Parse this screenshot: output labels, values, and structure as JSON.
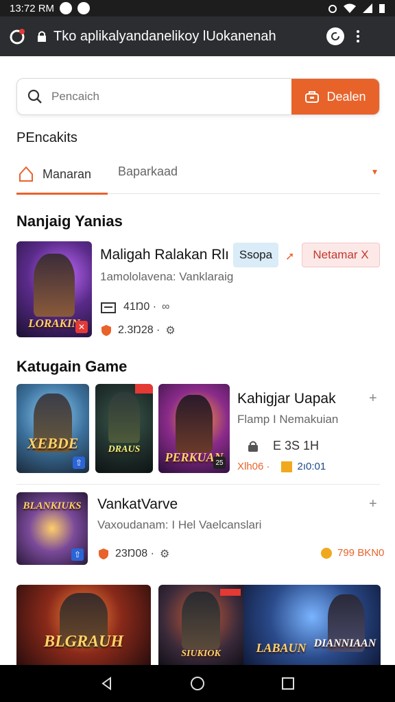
{
  "status_bar": {
    "time": "13:72 RM"
  },
  "browser": {
    "url": "Tko aplikalyandanelikoy lUokanenah"
  },
  "search": {
    "placeholder": "Pencaich",
    "deal_label": "Dealen"
  },
  "section_label": "PEncakits",
  "tabs": [
    {
      "label": "Manaran"
    },
    {
      "label": "Baparkaad"
    }
  ],
  "featured": {
    "heading": "Nanjaig Yanias",
    "title": "Maligah Ralakan Rlı",
    "tag_blue": "Ssopa",
    "tag_red": "Netamar X",
    "subtitle": "1amololavena: Vanklaraig",
    "stat_1": "41Ŋ0 ·",
    "stat_2": "2.3Ŋ28 ·",
    "thumb_label": "LORAKIN"
  },
  "category": {
    "heading": "Katugain Game",
    "thumbs": [
      "XEBDE",
      "DRAUS",
      "PERKUAN"
    ],
    "item_title": "Kahigjar Uapak",
    "item_subtitle": "Flamp I Nemakuian",
    "item_stat": "E 3S 1H",
    "item_meta_left": "Xlh06 ·",
    "item_meta_right": "2ı0:01",
    "thumb_badge": "25"
  },
  "second": {
    "title": "VankatVarve",
    "subtitle": "Vaxoudanam: I Hel Vaelcanslari",
    "stat_left": "23Ŋ08 ·",
    "stat_right": "799 BKN0",
    "thumb_label": "BLANKIUKS"
  },
  "bottom_thumbs": [
    "BLGRAUH",
    "SIUKIOK",
    "LABAUN",
    "DIANNIAAN"
  ],
  "colors": {
    "accent": "#e8632a",
    "tab_active": "#e8632a",
    "badge_blue": "#2a64d6"
  }
}
